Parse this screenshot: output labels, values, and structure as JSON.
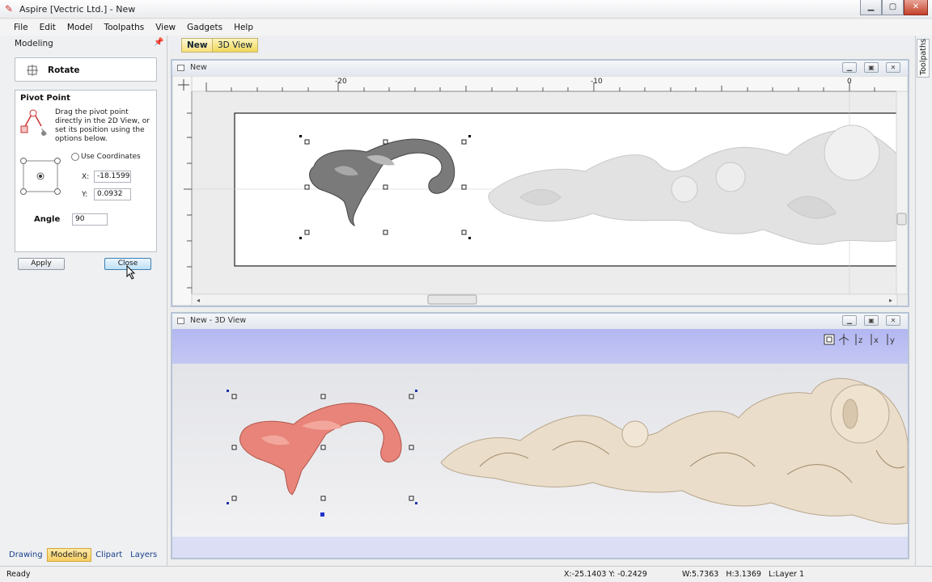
{
  "window": {
    "title": "Aspire [Vectric Ltd.] - New"
  },
  "menubar": {
    "items": [
      "File",
      "Edit",
      "Model",
      "Toolpaths",
      "View",
      "Gadgets",
      "Help"
    ]
  },
  "panel": {
    "title": "Modeling",
    "tool_name": "Rotate",
    "pivot": {
      "heading": "Pivot Point",
      "help_text": "Drag the pivot point directly in the 2D View, or set its position using the options below.",
      "use_coordinates_label": "Use Coordinates",
      "use_coordinates_checked": false,
      "x_label": "X:",
      "x_value": "-18.1599",
      "y_label": "Y:",
      "y_value": "0.0932"
    },
    "angle_label": "Angle",
    "angle_value": "90",
    "apply_label": "Apply",
    "close_label": "Close",
    "bottom_tabs": [
      {
        "label": "Drawing",
        "active": false
      },
      {
        "label": "Modeling",
        "active": true
      },
      {
        "label": "Clipart",
        "active": false
      },
      {
        "label": "Layers",
        "active": false
      }
    ]
  },
  "doc_tabs": [
    {
      "label": "New",
      "active": true
    },
    {
      "label": "3D View",
      "active": false
    }
  ],
  "right_tab": {
    "label": "Toolpaths"
  },
  "view2d": {
    "title": "New",
    "ruler_labels": [
      "-20",
      "-10",
      "0"
    ]
  },
  "view3d": {
    "title": "New - 3D View",
    "toolbar_icons": [
      "zoom-extents-icon",
      "iso-view-icon",
      "view-z-icon",
      "view-x-icon",
      "view-y-icon"
    ]
  },
  "colors": {
    "selection_3d": "#e8847a",
    "model_3d": "#eaddc9",
    "model_2d": "#7a7a7a",
    "sky_3d": "#b9bdf2"
  },
  "statusbar": {
    "ready": "Ready",
    "cursor": "X:-25.1403 Y: -0.2429",
    "size": "W:5.7363   H:3.1369   L:Layer 1"
  }
}
